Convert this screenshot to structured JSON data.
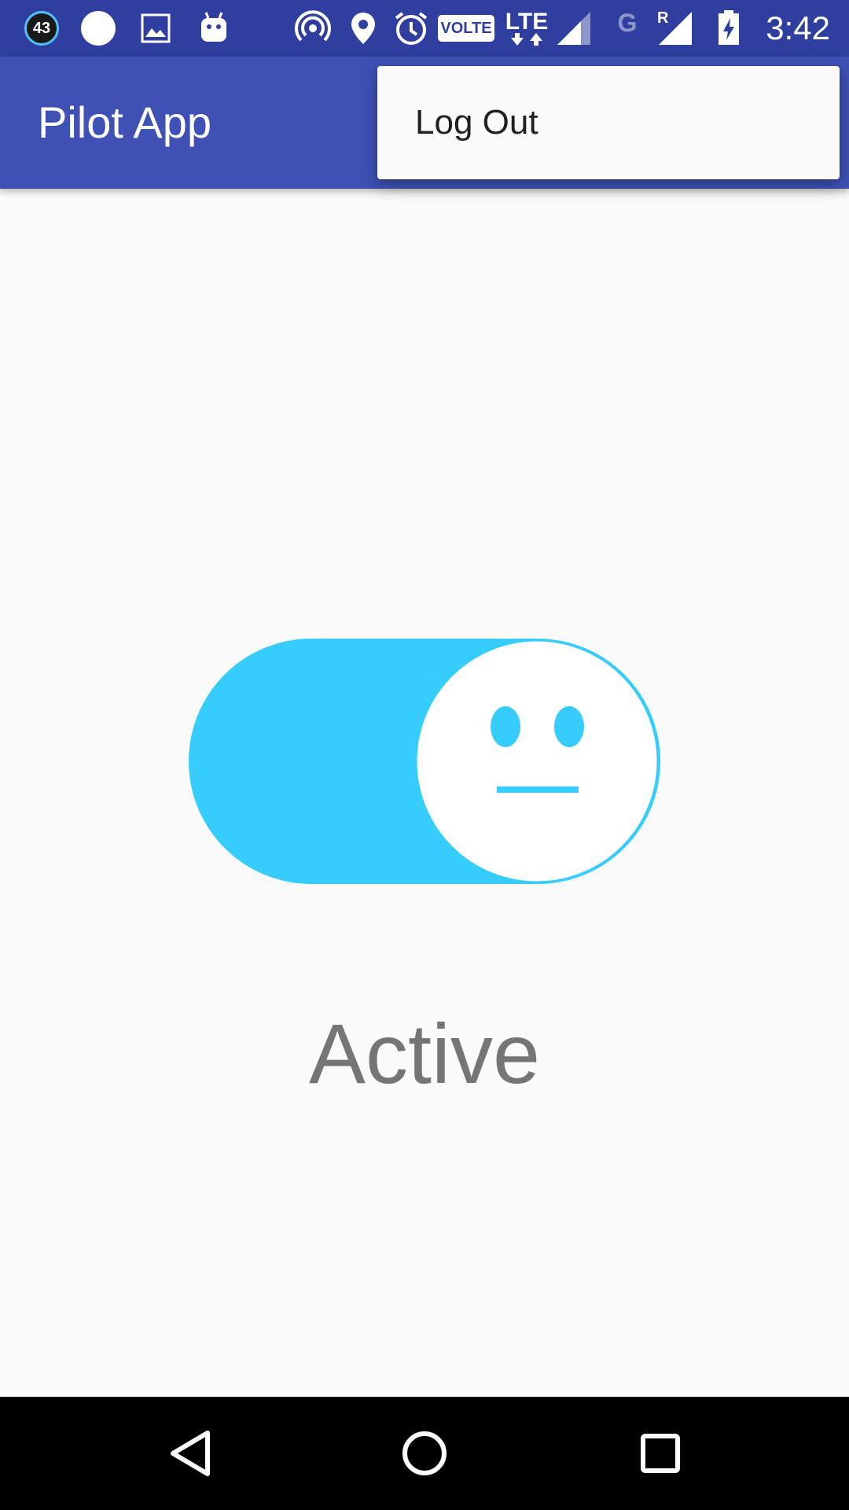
{
  "status_bar": {
    "notification_count": "43",
    "time": "3:42",
    "network_label": "LTE",
    "volte_label": "VOLTE",
    "secondary_network_label": "G",
    "roaming_label": "R",
    "icons": [
      "notification-count-icon",
      "circle-icon",
      "image-icon",
      "android-icon",
      "hotspot-icon",
      "location-icon",
      "alarm-icon",
      "volte-icon",
      "lte-icon",
      "signal-icon",
      "roaming-signal-icon",
      "battery-charging-icon"
    ]
  },
  "app_bar": {
    "title": "Pilot App"
  },
  "overflow_menu": {
    "items": [
      {
        "label": "Log Out"
      }
    ]
  },
  "toggle": {
    "state": "on",
    "thumb_face": "neutral-face-icon",
    "track_color": "#36cdfd",
    "thumb_color": "#ffffff"
  },
  "status": {
    "label": "Active"
  },
  "nav_bar": {
    "buttons": [
      "back-icon",
      "home-icon",
      "recents-icon"
    ]
  },
  "colors": {
    "status_bar": "#303f9f",
    "app_bar": "#3f51b5",
    "accent": "#36cdfd",
    "background": "#fafafa",
    "label_text": "#757575"
  }
}
